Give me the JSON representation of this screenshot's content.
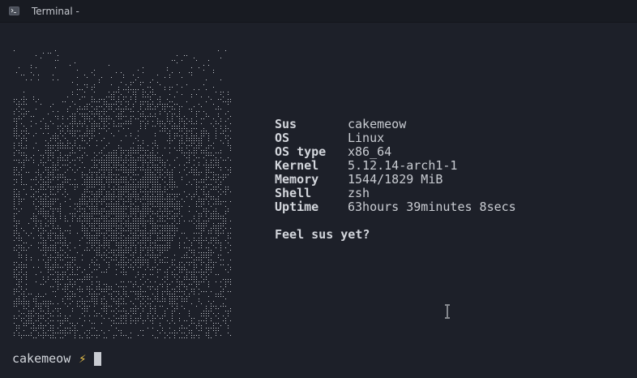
{
  "window": {
    "title": "Terminal -",
    "icon": "terminal-icon"
  },
  "ascii_art": {
    "description_icon": "braille-ascii-art",
    "color": "#cfd2d8"
  },
  "system_info": {
    "rows": [
      {
        "key": "Sus",
        "value": "cakemeow"
      },
      {
        "key": "OS",
        "value": "Linux"
      },
      {
        "key": "OS type",
        "value": "x86_64"
      },
      {
        "key": "Kernel",
        "value": "5.12.14-arch1-1"
      },
      {
        "key": "Memory",
        "value": "1544/1829 MiB"
      },
      {
        "key": "Shell",
        "value": "zsh"
      },
      {
        "key": "Uptime",
        "value": "63hours 39minutes 8secs"
      }
    ],
    "question": "Feel sus yet?"
  },
  "prompt": {
    "user": "cakemeow",
    "symbol": "⚡",
    "symbol_color": "#f2c94c"
  },
  "colors": {
    "background": "#1d2029",
    "titlebar": "#181b22",
    "text": "#c9ccd2"
  }
}
